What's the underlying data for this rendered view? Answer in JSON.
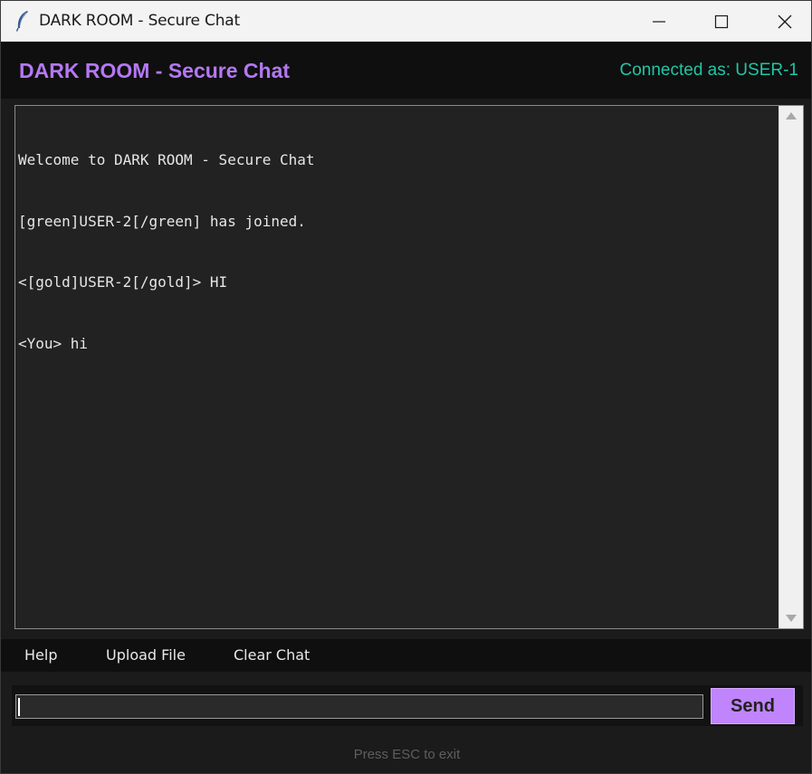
{
  "window": {
    "title": "DARK ROOM - Secure Chat",
    "icon": "feather-icon"
  },
  "header": {
    "app_title": "DARK ROOM - Secure Chat",
    "status": "Connected as: USER-1",
    "title_color": "#b478f2",
    "status_color": "#20c6a6"
  },
  "chat": {
    "messages": [
      "Welcome to DARK ROOM - Secure Chat",
      "[green]USER-2[/green] has joined.",
      "<[gold]USER-2[/gold]> HI",
      "<You> hi"
    ]
  },
  "toolbar": {
    "help_label": "Help",
    "upload_label": "Upload File",
    "clear_label": "Clear Chat"
  },
  "input": {
    "value": "",
    "send_label": "Send",
    "send_color": "#c084fc"
  },
  "footer": {
    "hint": "Press ESC to exit"
  }
}
